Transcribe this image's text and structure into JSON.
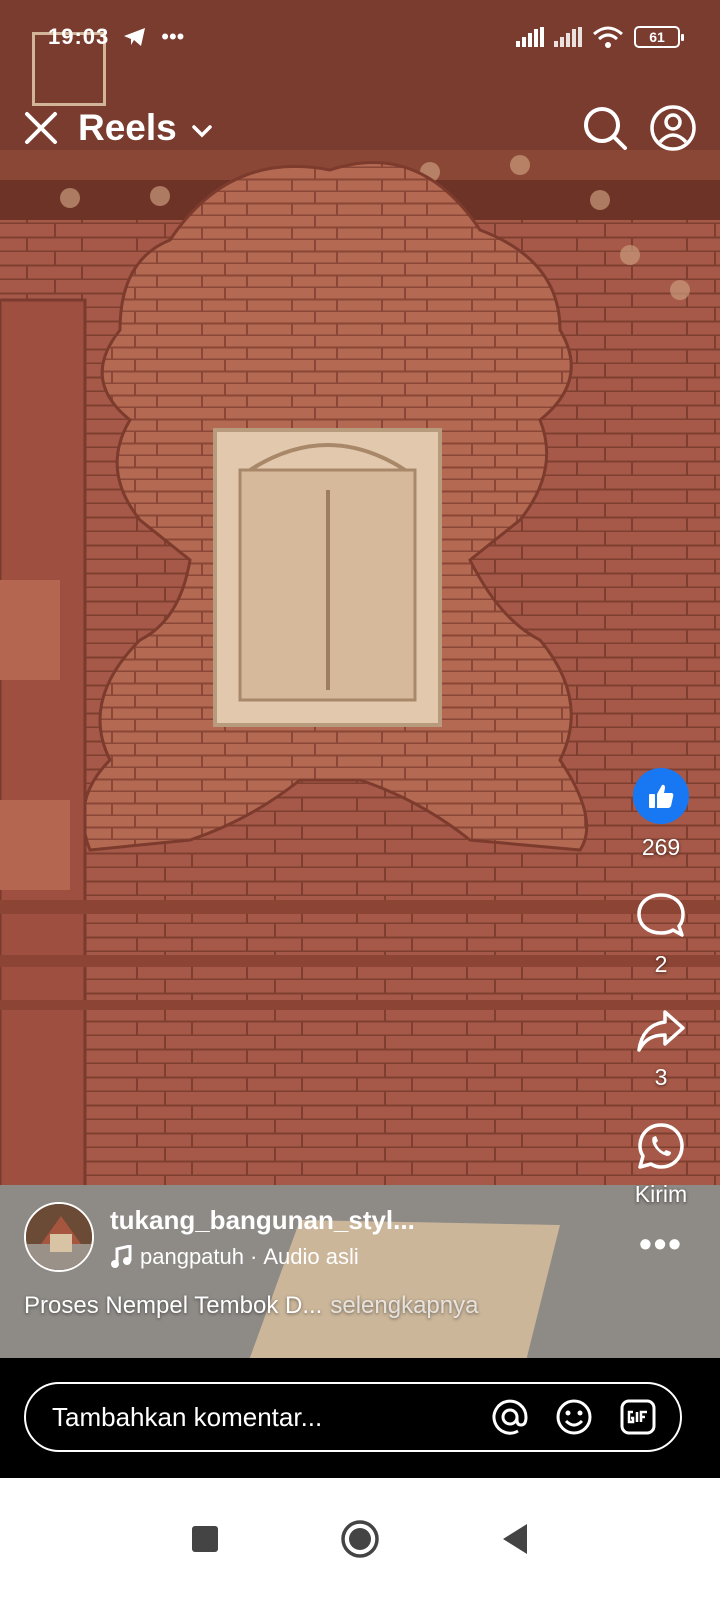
{
  "status_bar": {
    "time": "19:03",
    "battery": "61"
  },
  "header": {
    "title": "Reels"
  },
  "actions": {
    "likes": "269",
    "comments": "2",
    "shares": "3",
    "send_label": "Kirim"
  },
  "post": {
    "username": "tukang_bangunan_styl...",
    "audio_author": "pangpatuh",
    "audio_separator": "·",
    "audio_label": "Audio asli",
    "caption": "Proses Nempel Tembok D...",
    "see_more": "selengkapnya"
  },
  "comment_bar": {
    "placeholder": "Tambahkan komentar..."
  },
  "colors": {
    "like_blue": "#1877f2",
    "brick": "#a55a48",
    "nav_bg": "#ffffff"
  }
}
